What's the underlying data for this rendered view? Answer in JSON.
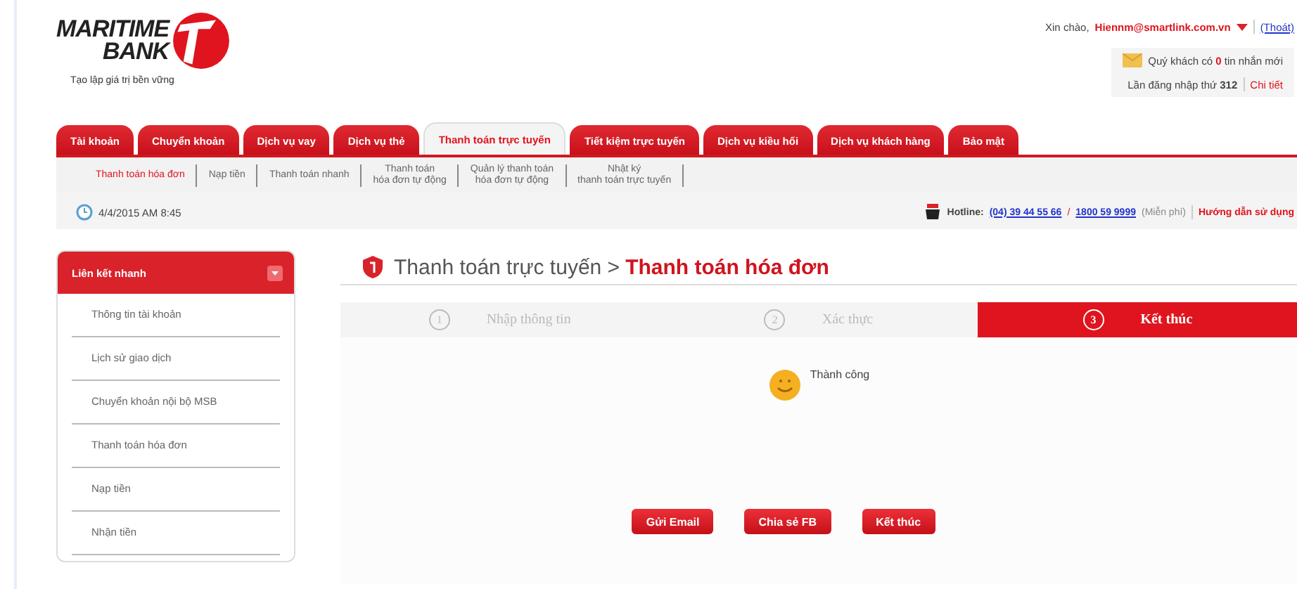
{
  "header": {
    "logo": {
      "line1": "MARITIME",
      "line2": "BANK",
      "slogan": "Tạo lập giá trị bền vững"
    },
    "greeting": {
      "prefix": "Xin chào,",
      "user": "Hiennm@smartlink.com.vn",
      "logout": "(Thoát)"
    },
    "messages": {
      "before": "Quý khách có",
      "count": "0",
      "after": "tin nhắn mới"
    },
    "login": {
      "label": "Lần đăng nhập thứ",
      "count": "312",
      "link": "Chi tiết"
    }
  },
  "tabs": [
    {
      "label": "Tài khoản",
      "selected": false
    },
    {
      "label": "Chuyển khoản",
      "selected": false
    },
    {
      "label": "Dịch vụ vay",
      "selected": false
    },
    {
      "label": "Dịch vụ thẻ",
      "selected": false
    },
    {
      "label": "Thanh toán trực tuyến",
      "selected": true
    },
    {
      "label": "Tiết kiệm trực tuyến",
      "selected": false
    },
    {
      "label": "Dịch vụ kiều hối",
      "selected": false
    },
    {
      "label": "Dịch vụ khách hàng",
      "selected": false
    },
    {
      "label": "Bảo mật",
      "selected": false
    }
  ],
  "subtabs": [
    {
      "label": "Thanh toán hóa đơn",
      "selected": true
    },
    {
      "label": "Nạp tiền",
      "selected": false
    },
    {
      "label": "Thanh toán nhanh",
      "selected": false
    },
    {
      "label": "Thanh toán\nhóa đơn tự động",
      "selected": false
    },
    {
      "label": "Quản lý thanh toán\nhóa đơn tự động",
      "selected": false
    },
    {
      "label": "Nhật ký\nthanh toán trực tuyến",
      "selected": false
    }
  ],
  "date": "4/4/2015 AM 8:45",
  "hotline": {
    "label": "Hotline:",
    "phone1": "(04) 39 44 55 66",
    "separator": "/",
    "phone2": "1800 59 9999",
    "note": "(Miễn phí)",
    "guide": "Hướng dẫn sử dụng"
  },
  "sidebar": {
    "title": "Liên kết nhanh",
    "items": [
      "Thông tin tài khoản",
      "Lịch sử giao dịch",
      "Chuyển khoản nội bộ MSB",
      "Thanh toán hóa đơn",
      "Nạp tiền",
      "Nhận tiền"
    ]
  },
  "breadcrumb": {
    "parent": "Thanh toán trực tuyến >",
    "current": "Thanh toán hóa đơn"
  },
  "steps": [
    {
      "number": "1",
      "label": "Nhập thông tin",
      "selected": false
    },
    {
      "number": "2",
      "label": "Xác thực",
      "selected": false
    },
    {
      "number": "3",
      "label": "Kết thúc",
      "selected": true
    }
  ],
  "result": {
    "text": "Thành công"
  },
  "buttons": [
    "Gửi Email",
    "Chia sẻ FB",
    "Kết thúc"
  ]
}
